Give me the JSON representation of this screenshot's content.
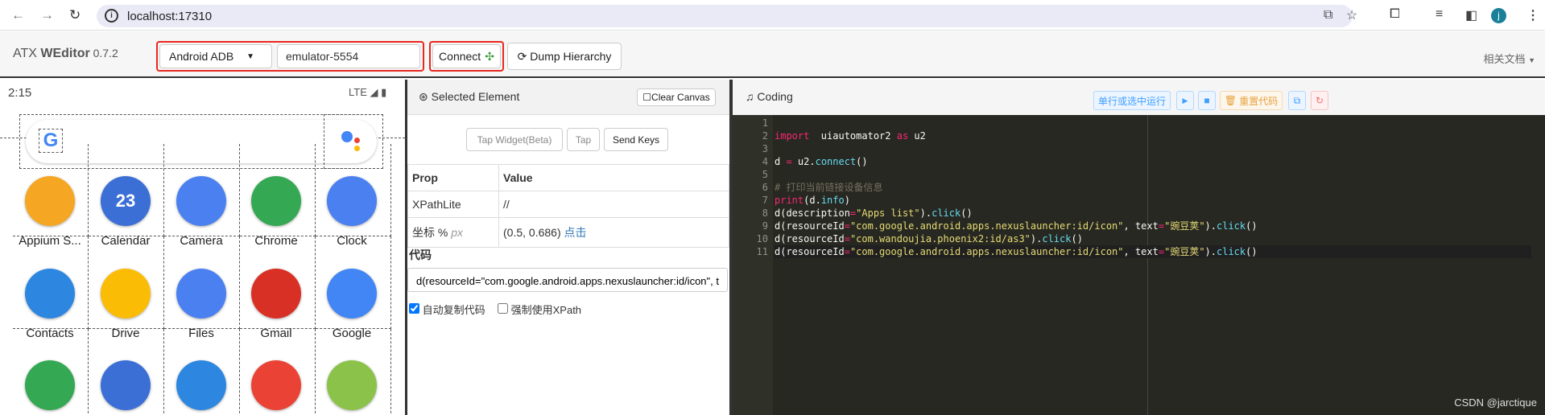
{
  "browser": {
    "url": "localhost:17310",
    "avatar_letter": "j"
  },
  "navbar": {
    "brand_light": "ATX ",
    "brand_bold": "WEditor",
    "version": " 0.7.2",
    "platform": "Android ADB",
    "device": "emulator-5554",
    "connect": "Connect",
    "dump": "Dump Hierarchy",
    "docs": "相关文档"
  },
  "phone": {
    "time": "2:15",
    "network": "LTE",
    "apps": [
      {
        "label": "Appium S...",
        "icon": "appium-icon",
        "color": "#f5a623"
      },
      {
        "label": "Calendar",
        "icon": "calendar-icon",
        "color": "#3b6fd6",
        "text": "23"
      },
      {
        "label": "Camera",
        "icon": "camera-icon",
        "color": "#4a80f0"
      },
      {
        "label": "Chrome",
        "icon": "chrome-icon",
        "color": "#34a853"
      },
      {
        "label": "Clock",
        "icon": "clock-icon",
        "color": "#4a80f0"
      },
      {
        "label": "Contacts",
        "icon": "contacts-icon",
        "color": "#2d87e0"
      },
      {
        "label": "Drive",
        "icon": "drive-icon",
        "color": "#fbbc05"
      },
      {
        "label": "Files",
        "icon": "files-icon",
        "color": "#4a80f0"
      },
      {
        "label": "Gmail",
        "icon": "gmail-icon",
        "color": "#d93025"
      },
      {
        "label": "Google",
        "icon": "google-icon",
        "color": "#4285f4"
      },
      {
        "icon": "maps-icon",
        "color": "#34a853"
      },
      {
        "icon": "messages-icon",
        "color": "#3b6fd6"
      },
      {
        "icon": "phone-icon",
        "color": "#2d87e0"
      },
      {
        "icon": "photos-icon",
        "color": "#ea4335"
      },
      {
        "icon": "android-icon",
        "color": "#8bc34a"
      }
    ]
  },
  "selected": {
    "title": "Selected Element",
    "clear": "Clear Canvas",
    "tap_widget": "Tap Widget(Beta)",
    "tap": "Tap",
    "send_keys": "Send Keys",
    "prop_header": "Prop",
    "value_header": "Value",
    "xpath_label": "XPathLite",
    "xpath_value": "//",
    "coord_label": "坐标 %",
    "coord_unit": "px",
    "coord_value": "(0.5, 0.686)",
    "coord_click": "点击",
    "code_label": "代码",
    "code_value": "d(resourceId=\"com.google.android.apps.nexuslauncher:id/icon\", text=\"豌豆荚\").click()",
    "auto_copy": "自动复制代码",
    "auto_copy_checked": true,
    "force_xpath": "强制使用XPath",
    "force_xpath_checked": false
  },
  "coding": {
    "title": "Coding",
    "run_line": "单行或选中运行",
    "reset": "重置代码",
    "colors": {
      "run": "#409eff",
      "reset": "#e6a23c",
      "restart": "#f56c6c"
    },
    "lines": [
      [],
      [
        [
          "kw",
          "import"
        ],
        [
          "",
          "  uiautomator2 "
        ],
        [
          "kw",
          "as"
        ],
        [
          "",
          " u2"
        ]
      ],
      [],
      [
        [
          "",
          "d "
        ],
        [
          "op",
          "="
        ],
        [
          "",
          " u2."
        ],
        [
          "fn",
          "connect"
        ],
        [
          "",
          "()"
        ]
      ],
      [],
      [
        [
          "cm",
          "# 打印当前链接设备信息"
        ]
      ],
      [
        [
          "kw",
          "print"
        ],
        [
          "",
          "(d."
        ],
        [
          "fn",
          "info"
        ],
        [
          "",
          ")"
        ]
      ],
      [
        [
          "",
          "d(description"
        ],
        [
          "op",
          "="
        ],
        [
          "str",
          "\"Apps list\""
        ],
        [
          "",
          ")."
        ],
        [
          "fn",
          "click"
        ],
        [
          "",
          "()"
        ]
      ],
      [
        [
          "",
          "d(resourceId"
        ],
        [
          "op",
          "="
        ],
        [
          "str",
          "\"com.google.android.apps.nexuslauncher:id/icon\""
        ],
        [
          "",
          ", text"
        ],
        [
          "op",
          "="
        ],
        [
          "str",
          "\"豌豆荚\""
        ],
        [
          "",
          ")."
        ],
        [
          "fn",
          "click"
        ],
        [
          "",
          "()"
        ]
      ],
      [
        [
          "",
          "d(resourceId"
        ],
        [
          "op",
          "="
        ],
        [
          "str",
          "\"com.wandoujia.phoenix2:id/as3\""
        ],
        [
          "",
          ")."
        ],
        [
          "fn",
          "click"
        ],
        [
          "",
          "()"
        ]
      ],
      [
        [
          "",
          "d(resourceId"
        ],
        [
          "op",
          "="
        ],
        [
          "str",
          "\"com.google.android.apps.nexuslauncher:id/icon\""
        ],
        [
          "",
          ", text"
        ],
        [
          "op",
          "="
        ],
        [
          "str",
          "\"豌豆荚\""
        ],
        [
          "",
          ")."
        ],
        [
          "fn",
          "click"
        ],
        [
          "",
          "()"
        ]
      ]
    ]
  },
  "watermark": "CSDN @jarctique"
}
